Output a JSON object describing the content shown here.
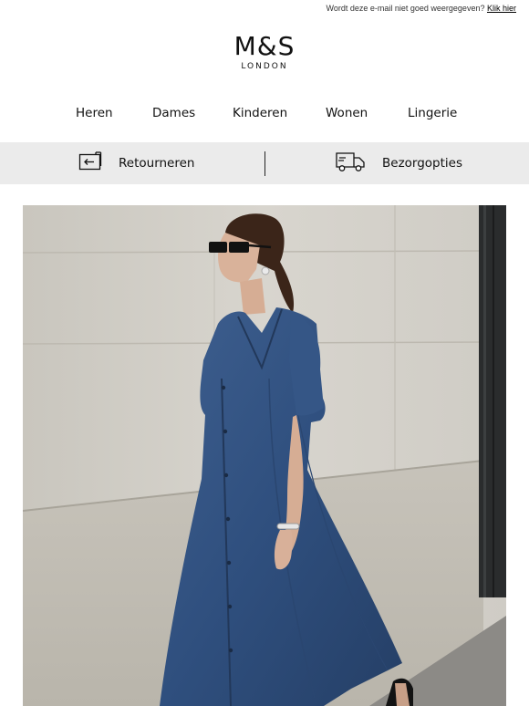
{
  "preheader": {
    "text": "Wordt deze e-mail niet goed weergegeven?",
    "link": "Klik hier"
  },
  "logo": {
    "main": "M&S",
    "sub": "LONDON"
  },
  "nav": {
    "items": [
      {
        "label": "Heren"
      },
      {
        "label": "Dames"
      },
      {
        "label": "Kinderen"
      },
      {
        "label": "Wonen"
      },
      {
        "label": "Lingerie"
      }
    ]
  },
  "services": {
    "returns": {
      "label": "Retourneren",
      "icon": "returns-icon"
    },
    "delivery": {
      "label": "Bezorgopties",
      "icon": "delivery-truck-icon"
    }
  },
  "hero": {
    "image": "woman-in-denim-dress-photo"
  }
}
